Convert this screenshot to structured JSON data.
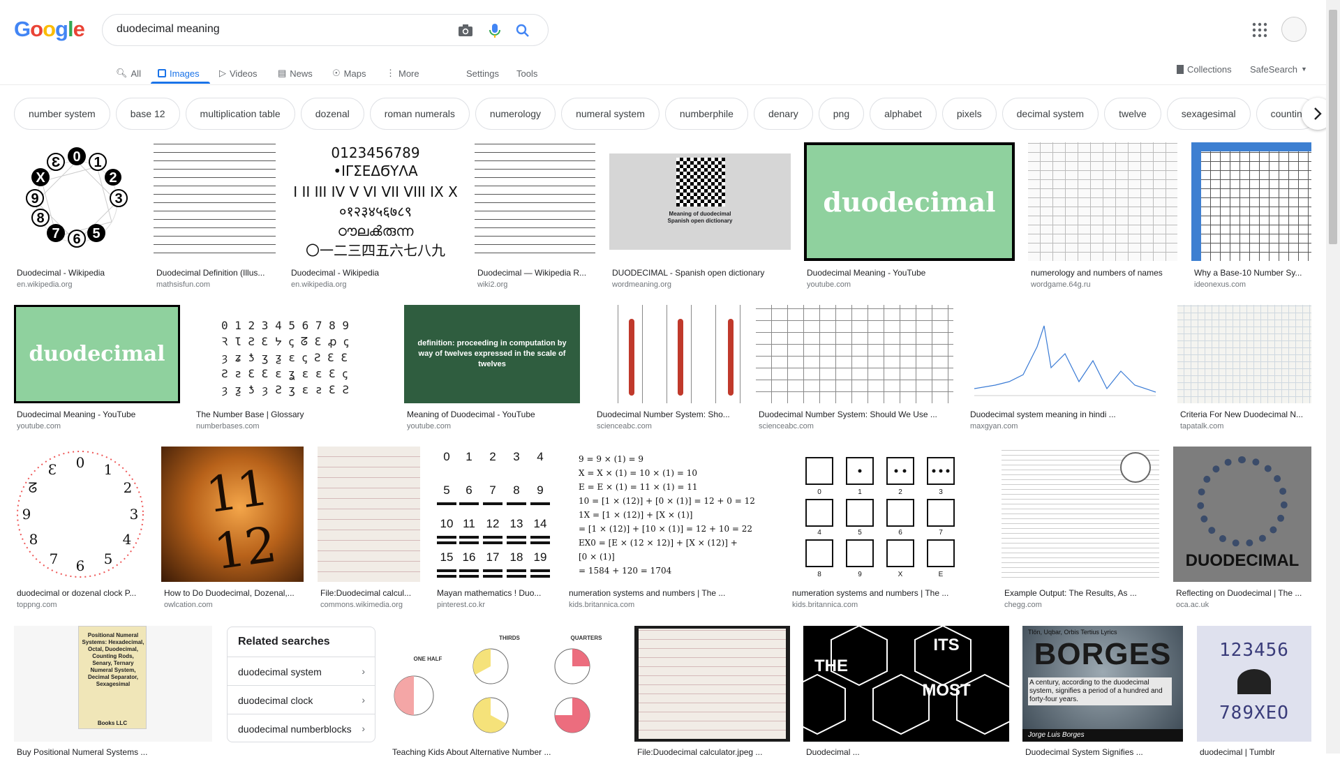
{
  "header": {
    "logo": [
      "G",
      "o",
      "o",
      "g",
      "l",
      "e"
    ],
    "logo_colors": [
      "#4285f4",
      "#ea4335",
      "#fbbc05",
      "#4285f4",
      "#34a853",
      "#ea4335"
    ],
    "query": "duodecimal meaning"
  },
  "tabs": {
    "all": "All",
    "images": "Images",
    "videos": "Videos",
    "news": "News",
    "maps": "Maps",
    "more": "More",
    "settings": "Settings",
    "tools": "Tools",
    "collections": "Collections",
    "safesearch": "SafeSearch"
  },
  "chips": [
    "number system",
    "base 12",
    "multiplication table",
    "dozenal",
    "roman numerals",
    "numerology",
    "numeral system",
    "numberphile",
    "denary",
    "png",
    "alphabet",
    "pixels",
    "decimal system",
    "twelve",
    "sexagesimal",
    "countin"
  ],
  "results_row1": [
    {
      "title": "Duodecimal - Wikipedia",
      "source": "en.wikipedia.org"
    },
    {
      "title": "Duodecimal Definition (Illus...",
      "source": "mathsisfun.com"
    },
    {
      "title": "Duodecimal - Wikipedia",
      "source": "en.wikipedia.org"
    },
    {
      "title": "Duodecimal — Wikipedia R...",
      "source": "wiki2.org"
    },
    {
      "title": "DUODECIMAL - Spanish open dictionary",
      "source": "wordmeaning.org"
    },
    {
      "title": "Duodecimal Meaning - YouTube",
      "source": "youtube.com"
    },
    {
      "title": "numerology and numbers of names",
      "source": "wordgame.64g.ru"
    },
    {
      "title": "Why a Base-10 Number Sy...",
      "source": "ideonexus.com"
    }
  ],
  "results_row2": [
    {
      "title": "Duodecimal Meaning - YouTube",
      "source": "youtube.com"
    },
    {
      "title": "The Number Base | Glossary",
      "source": "numberbases.com"
    },
    {
      "title": "Meaning of Duodecimal - YouTube",
      "source": "youtube.com"
    },
    {
      "title": "Duodecimal Number System: Sho...",
      "source": "scienceabc.com"
    },
    {
      "title": "Duodecimal Number System: Should We Use ...",
      "source": "scienceabc.com"
    },
    {
      "title": "Duodecimal system meaning in hindi ...",
      "source": "maxgyan.com"
    },
    {
      "title": "Criteria For New Duodecimal N...",
      "source": "tapatalk.com"
    }
  ],
  "results_row3": [
    {
      "title": "duodecimal or dozenal clock P...",
      "source": "toppng.com"
    },
    {
      "title": "How to Do Duodecimal, Dozenal,...",
      "source": "owlcation.com"
    },
    {
      "title": "File:Duodecimal calcul...",
      "source": "commons.wikimedia.org"
    },
    {
      "title": "Mayan mathematics ! Duo...",
      "source": "pinterest.co.kr"
    },
    {
      "title": "numeration systems and numbers | The ...",
      "source": "kids.britannica.com"
    },
    {
      "title": "numeration systems and numbers | The ...",
      "source": "kids.britannica.com"
    },
    {
      "title": "Example Output: The Results, As ...",
      "source": "chegg.com"
    },
    {
      "title": "Reflecting on Duodecimal | The ...",
      "source": "oca.ac.uk"
    }
  ],
  "results_row4": [
    {
      "title": "Buy Positional Numeral Systems ..."
    },
    {
      "title": "Teaching Kids About Alternative Number ..."
    },
    {
      "title": "File:Duodecimal calculator.jpeg ..."
    },
    {
      "title": "Duodecimal ..."
    },
    {
      "title": "Duodecimal System Signifies ..."
    },
    {
      "title": "duodecimal | Tumblr"
    }
  ],
  "related": {
    "heading": "Related searches",
    "items": [
      "duodecimal system",
      "duodecimal clock",
      "duodecimal numberblocks"
    ]
  },
  "thumb_text": {
    "duodecimal_green": "duodecimal",
    "wordmeaning_caption": "Meaning of duodecimal",
    "wordmeaning_caption2": "Spanish open dictionary",
    "definition": "definition: proceeding in computation by way of twelves expressed in the scale of twelves",
    "book_title": "Positional Numeral Systems: Hexadecimal, Octal, Duodecimal, Counting Rods, Senary, Ternary Numeral System, Decimal Separator, Sexagesimal",
    "book_publisher": "Books LLC",
    "oca_word": "DUODECIMAL",
    "borges": "BORGES",
    "borges_top": "Tlön, Uqbar, Orbis Tertius Lyrics",
    "borges_quote": "A century, according to the duodecimal system, signifies a period of a hundred and forty-four years.",
    "borges_author": "Jorge Luis Borges",
    "tumblr_line1": "123456",
    "tumblr_line2": "789XEO",
    "hex_words": [
      "THE",
      "ITS",
      "MOST"
    ],
    "pie_labels": [
      "ONE HALF",
      "THIRDS",
      "QUARTERS"
    ]
  },
  "colors": {
    "accent": "#1a73e8",
    "youtube_green": "#8fd19e",
    "chalkboard": "#2f5d3f"
  }
}
